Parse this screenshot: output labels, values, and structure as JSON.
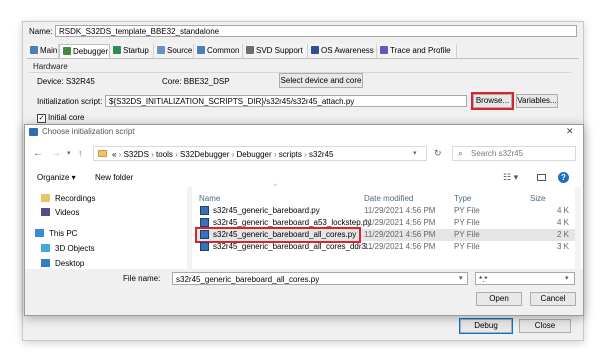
{
  "eclipse": {
    "name_label": "Name:",
    "name_value": "RSDK_S32DS_template_BBE32_standalone",
    "tabs": [
      {
        "label": "Main",
        "icon": "main-tab-icon",
        "color": "#4a7ebb"
      },
      {
        "label": "Debugger",
        "icon": "debugger-tab-icon",
        "color": "#3e8f3e"
      },
      {
        "label": "Startup",
        "icon": "startup-tab-icon",
        "color": "#2e8b57"
      },
      {
        "label": "Source",
        "icon": "source-tab-icon",
        "color": "#6b8fbf"
      },
      {
        "label": "Common",
        "icon": "common-tab-icon",
        "color": "#4a7ebb"
      },
      {
        "label": "SVD Support",
        "icon": "svd-tab-icon",
        "color": "#6d6d6d"
      },
      {
        "label": "OS Awareness",
        "icon": "os-tab-icon",
        "color": "#2f4f8f"
      },
      {
        "label": "Trace and Profile",
        "icon": "trace-tab-icon",
        "color": "#5b5bbd"
      }
    ],
    "hardware_group": "Hardware",
    "device_label": "Device: S32R45",
    "core_label": "Core: BBE32_DSP",
    "select_device_button": "Select device and core",
    "init_script_label": "Initialization script:",
    "init_script_value": "${S32DS_INITIALIZATION_SCRIPTS_DIR}/s32r45/s32r45_attach.py",
    "browse_button": "Browse...",
    "variables_button": "Variables...",
    "initial_core_label": "Initial core",
    "debug_button": "Debug",
    "close_button": "Close"
  },
  "chooser": {
    "title": "Choose initialization script",
    "breadcrumb": [
      "«",
      "S32DS",
      "tools",
      "S32Debugger",
      "Debugger",
      "scripts",
      "s32r45"
    ],
    "search_placeholder": "Search s32r45",
    "organize_label": "Organize ▾",
    "new_folder_label": "New folder",
    "nav_items": [
      {
        "label": "Recordings",
        "icon": "folder-icon"
      },
      {
        "label": "Videos",
        "icon": "videos-icon"
      },
      {
        "label": "This PC",
        "icon": "computer-icon"
      },
      {
        "label": "3D Objects",
        "icon": "3d-objects-icon"
      },
      {
        "label": "Desktop",
        "icon": "desktop-icon"
      }
    ],
    "columns": {
      "name": "Name",
      "date": "Date modified",
      "type": "Type",
      "size": "Size"
    },
    "files": [
      {
        "name": "s32r45_generic_bareboard.py",
        "date": "11/29/2021 4:56 PM",
        "type": "PY File",
        "size": "4 K"
      },
      {
        "name": "s32r45_generic_bareboard_a53_lockstep.py",
        "date": "11/29/2021 4:56 PM",
        "type": "PY File",
        "size": "4 K"
      },
      {
        "name": "s32r45_generic_bareboard_all_cores.py",
        "date": "11/29/2021 4:56 PM",
        "type": "PY File",
        "size": "2 K"
      },
      {
        "name": "s32r45_generic_bareboard_all_cores_ddr3...",
        "date": "11/29/2021 4:56 PM",
        "type": "PY File",
        "size": "3 K"
      }
    ],
    "file_name_label": "File name:",
    "file_name_value": "s32r45_generic_bareboard_all_cores.py",
    "filter_value": "*.*",
    "open_button": "Open",
    "cancel_button": "Cancel",
    "close_glyph": "✕"
  },
  "colors": {
    "highlight": "#d9232d",
    "selected_row": "#cce8ff",
    "accent": "#0078d7"
  }
}
